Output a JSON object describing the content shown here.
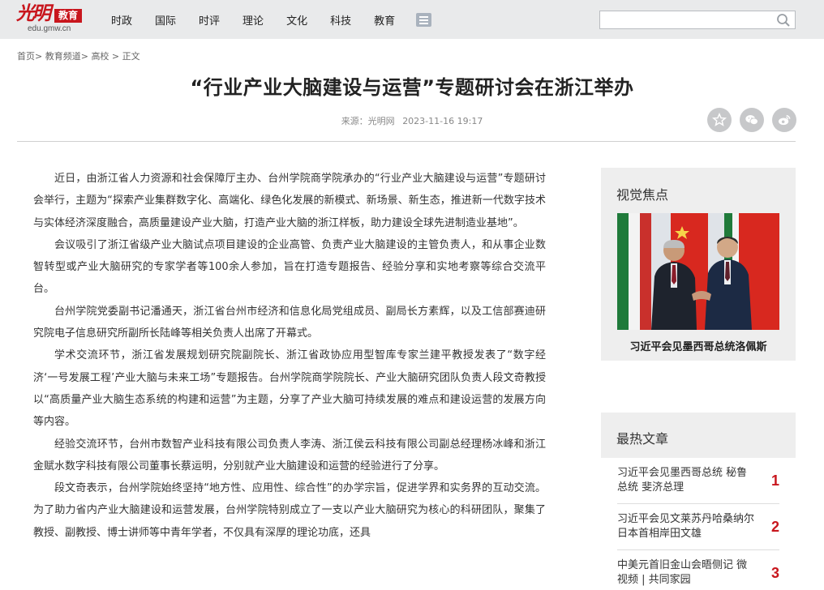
{
  "header": {
    "logo_brush": "光明",
    "logo_badge": "教育",
    "logo_url": "edu.gmw.cn",
    "nav": [
      "时政",
      "国际",
      "时评",
      "理论",
      "文化",
      "科技",
      "教育"
    ],
    "search_placeholder": ""
  },
  "breadcrumb": [
    "首页>",
    "教育频道>",
    "高校 >",
    "正文"
  ],
  "article": {
    "title": "“行业产业大脑建设与运营”专题研讨会在浙江举办",
    "source": "来源：光明网",
    "date": "2023-11-16 19:17",
    "paragraphs": [
      "近日，由浙江省人力资源和社会保障厅主办、台州学院商学院承办的“行业产业大脑建设与运营”专题研讨会举行，主题为“探索产业集群数字化、高端化、绿色化发展的新模式、新场景、新生态，推进新一代数字技术与实体经济深度融合，高质量建设产业大脑，打造产业大脑的浙江样板，助力建设全球先进制造业基地”。",
      "会议吸引了浙江省级产业大脑试点项目建设的企业高管、负责产业大脑建设的主管负责人，和从事企业数智转型或产业大脑研究的专家学者等100余人参加，旨在打造专题报告、经验分享和实地考察等综合交流平台。",
      "台州学院党委副书记潘通天，浙江省台州市经济和信息化局党组成员、副局长方素辉，以及工信部赛迪研究院电子信息研究所副所长陆峰等相关负责人出席了开幕式。",
      "学术交流环节，浙江省发展规划研究院副院长、浙江省政协应用型智库专家兰建平教授发表了“数字经济‘一号发展工程’产业大脑与未来工场”专题报告。台州学院商学院院长、产业大脑研究团队负责人段文奇教授以“高质量产业大脑生态系统的构建和运营”为主题，分享了产业大脑可持续发展的难点和建设运营的发展方向等内容。",
      "经验交流环节，台州市数智产业科技有限公司负责人李涛、浙江侯云科技有限公司副总经理杨冰峰和浙江金赋水数字科技有限公司董事长蔡运明，分别就产业大脑建设和运营的经验进行了分享。",
      "段文奇表示，台州学院始终坚持“地方性、应用性、综合性”的办学宗旨，促进学界和实务界的互动交流。为了助力省内产业大脑建设和运营发展，台州学院特别成立了一支以产业大脑研究为核心的科研团队，聚集了教授、副教授、博士讲师等中青年学者，不仅具有深厚的理论功底，还具"
    ]
  },
  "sidebar": {
    "focus_title": "视觉焦点",
    "focus_caption": "习近平会见墨西哥总统洛佩斯",
    "hot_title": "最热文章",
    "hot_items": [
      {
        "text": "习近平会见墨西哥总统 秘鲁总统 斐济总理",
        "rank": "1"
      },
      {
        "text": "习近平会见文莱苏丹哈桑纳尔 日本首相岸田文雄",
        "rank": "2"
      },
      {
        "text": "中美元首旧金山会晤侧记 微视频 | 共同家园",
        "rank": "3"
      }
    ]
  },
  "colors": {
    "brand_red": "#c8161d",
    "topbar": "#e9eaeb",
    "panel": "#eeeeee"
  }
}
